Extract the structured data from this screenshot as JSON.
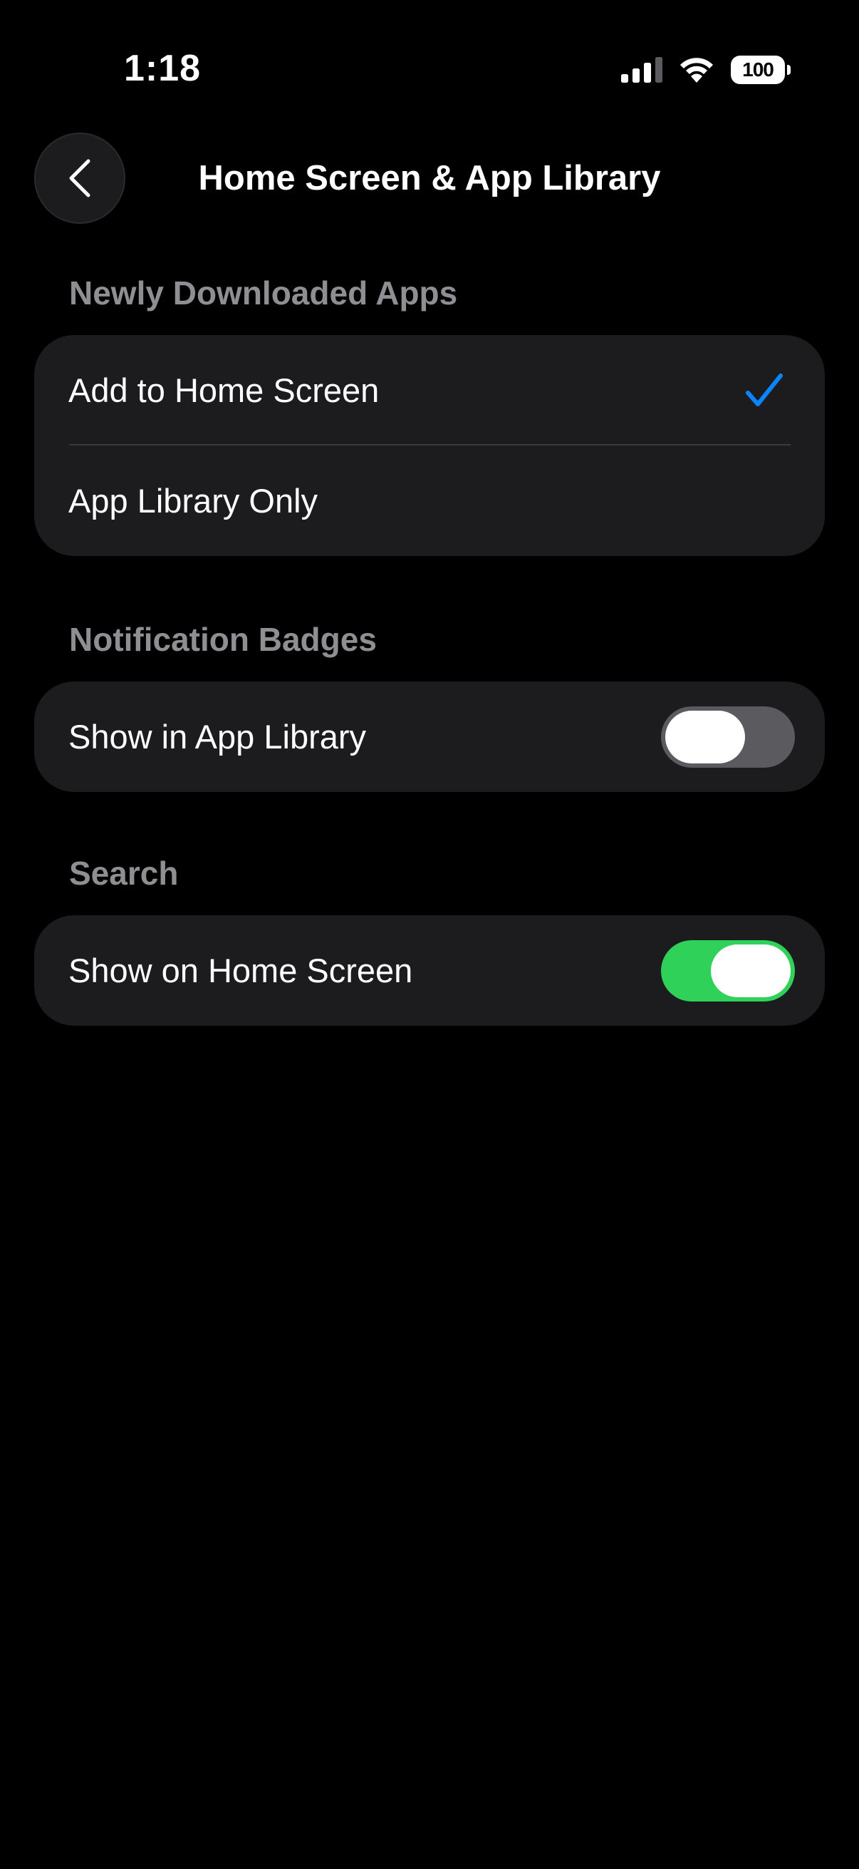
{
  "status_bar": {
    "time": "1:18",
    "battery_level": "100",
    "icons": [
      "signal-icon",
      "wifi-icon",
      "battery-icon"
    ]
  },
  "nav": {
    "back_icon": "chevron-left-icon",
    "title": "Home Screen & App Library"
  },
  "sections": {
    "newly_downloaded": {
      "header": "Newly Downloaded Apps",
      "options": [
        {
          "label": "Add to Home Screen",
          "selected": true
        },
        {
          "label": "App Library Only",
          "selected": false
        }
      ]
    },
    "notification_badges": {
      "header": "Notification Badges",
      "row": {
        "label": "Show in App Library",
        "enabled": false
      }
    },
    "search": {
      "header": "Search",
      "row": {
        "label": "Show on Home Screen",
        "enabled": true
      }
    }
  },
  "colors": {
    "background": "#000000",
    "group_background": "#1c1c1e",
    "section_header": "#8e8e93",
    "accent_blue": "#0a84ff",
    "toggle_on": "#30d158",
    "toggle_off": "#5b5b5f"
  }
}
